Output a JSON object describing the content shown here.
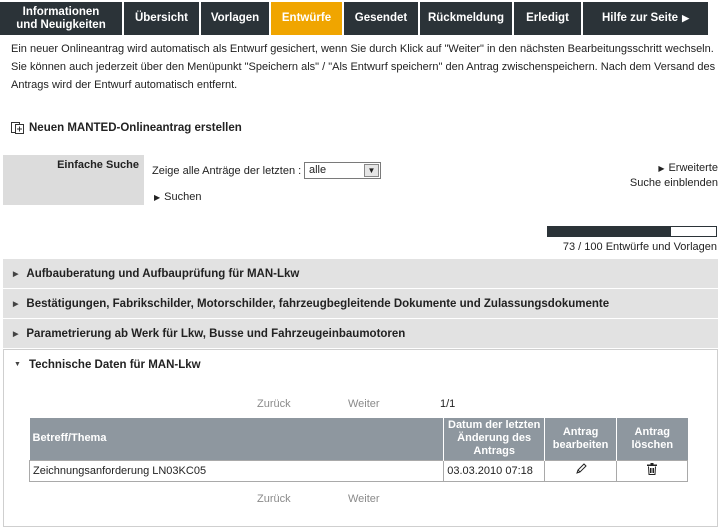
{
  "nav": {
    "tabs": [
      {
        "label": "Informationen\nund Neuigkeiten",
        "width": 124
      },
      {
        "label": "Übersicht",
        "width": 77
      },
      {
        "label": "Vorlagen",
        "width": 70
      },
      {
        "label": "Entwürfe",
        "width": 73,
        "active": true
      },
      {
        "label": "Gesendet",
        "width": 76
      },
      {
        "label": "Rückmeldung",
        "width": 94
      },
      {
        "label": "Erledigt",
        "width": 69
      },
      {
        "label": "Hilfe zur Seite",
        "width": 127,
        "arrow": true
      }
    ]
  },
  "intro": {
    "text": "Ein neuer Onlineantrag wird automatisch als Entwurf gesichert, wenn Sie durch Klick auf \"Weiter\" in den nächsten Bearbeitungsschritt wechseln. Sie können auch jederzeit über den Menüpunkt \"Speichern als\" / \"Als Entwurf speichern\" den Antrag zwischenspeichern. Nach dem Versand des Antrags wird der Entwurf automatisch entfernt."
  },
  "create": {
    "label": "Neuen MANTED-Onlineantrag erstellen",
    "icon": "add-document-icon"
  },
  "search": {
    "label": "Einfache Suche",
    "prompt": "Zeige alle Anträge der letzten :",
    "select_value": "alle",
    "submit": "Suchen",
    "advanced_line1": "Erweiterte",
    "advanced_line2": "Suche einblenden"
  },
  "quota": {
    "text": "73 / 100 Entwürfe und Vorlagen",
    "used": 73,
    "max": 100
  },
  "groups": [
    {
      "label": "Aufbauberatung und Aufbauprüfung für MAN-Lkw"
    },
    {
      "label": "Bestätigungen, Fabrikschilder, Motorschilder, fahrzeugbegleitende Dokumente und Zulassungsdokumente"
    },
    {
      "label": "Parametrierung ab Werk für Lkw, Busse und Fahrzeugeinbaumotoren"
    },
    {
      "label": "Technische Daten für MAN-Lkw",
      "open": true
    }
  ],
  "pager": {
    "back": "Zurück",
    "next": "Weiter",
    "page": "1/1"
  },
  "table": {
    "headers": {
      "subject": "Betreff/Thema",
      "date": "Datum der letzten Änderung des Antrags",
      "edit": "Antrag bearbeiten",
      "delete": "Antrag löschen"
    },
    "rows": [
      {
        "subject": "Zeichnungsanforderung LN03KC05",
        "date": "03.03.2010 07:18"
      }
    ]
  },
  "colors": {
    "nav_bg": "#2b3338",
    "nav_active": "#f0a500",
    "header_gray": "#8e979f"
  }
}
